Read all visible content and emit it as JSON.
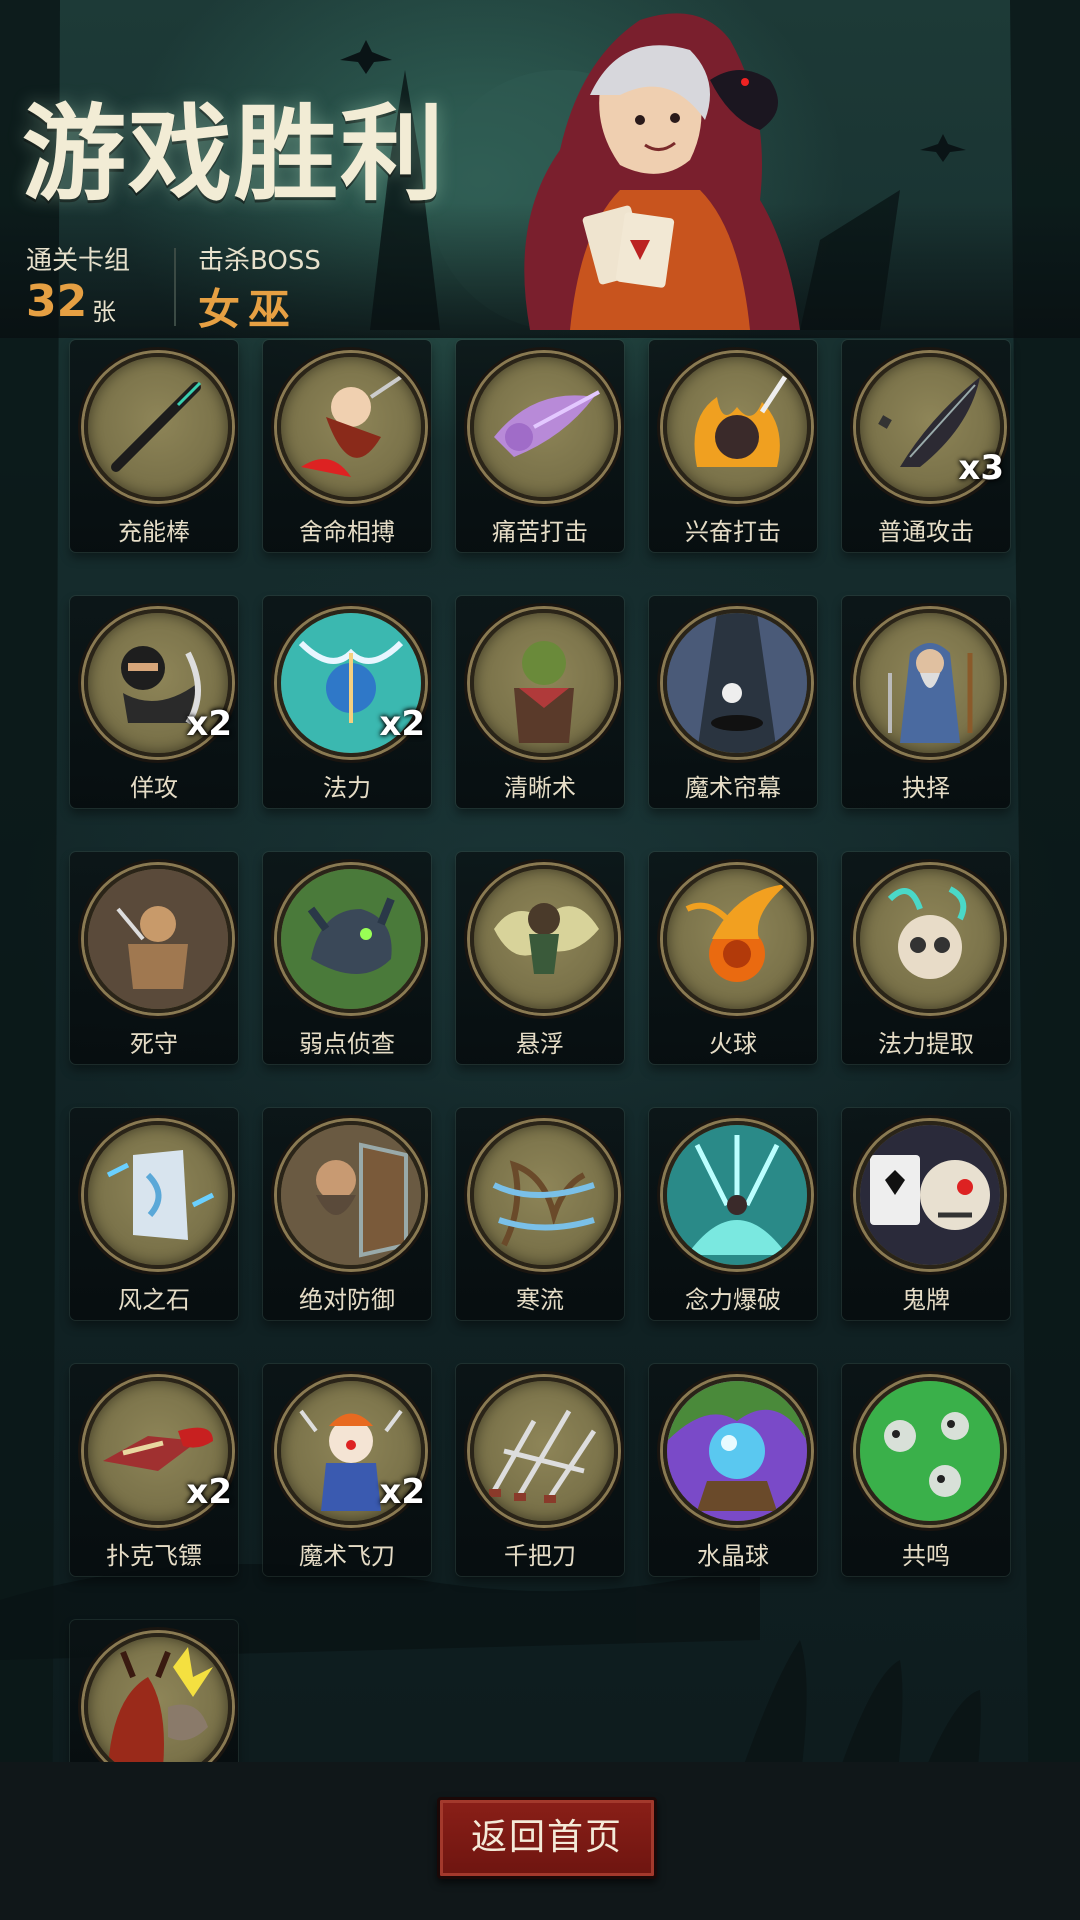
{
  "header": {
    "title": "游戏胜利",
    "deck_label": "通关卡组",
    "deck_count": "32",
    "deck_unit": "张",
    "boss_label": "击杀BOSS",
    "boss_name": "女巫"
  },
  "cards": [
    {
      "name": "充能棒",
      "count": "",
      "icon": "wand-icon"
    },
    {
      "name": "舍命相搏",
      "count": "",
      "icon": "desperate-fighter-icon"
    },
    {
      "name": "痛苦打击",
      "count": "",
      "icon": "pain-strike-icon"
    },
    {
      "name": "兴奋打击",
      "count": "",
      "icon": "excited-strike-icon"
    },
    {
      "name": "普通攻击",
      "count": "x3",
      "icon": "feather-attack-icon"
    },
    {
      "name": "佯攻",
      "count": "x2",
      "icon": "ninja-feint-icon"
    },
    {
      "name": "法力",
      "count": "x2",
      "icon": "mana-orb-icon"
    },
    {
      "name": "清晰术",
      "count": "",
      "icon": "goblin-icon"
    },
    {
      "name": "魔术帘幕",
      "count": "",
      "icon": "magic-curtain-icon"
    },
    {
      "name": "抉择",
      "count": "",
      "icon": "wizard-choice-icon"
    },
    {
      "name": "死守",
      "count": "",
      "icon": "defender-icon"
    },
    {
      "name": "弱点侦查",
      "count": "",
      "icon": "wolf-icon"
    },
    {
      "name": "悬浮",
      "count": "",
      "icon": "levitate-icon"
    },
    {
      "name": "火球",
      "count": "",
      "icon": "fireball-icon"
    },
    {
      "name": "法力提取",
      "count": "",
      "icon": "skull-mana-icon"
    },
    {
      "name": "风之石",
      "count": "",
      "icon": "wind-stone-icon"
    },
    {
      "name": "绝对防御",
      "count": "",
      "icon": "dwarf-shield-icon"
    },
    {
      "name": "寒流",
      "count": "",
      "icon": "cold-wave-icon"
    },
    {
      "name": "念力爆破",
      "count": "",
      "icon": "telekinetic-blast-icon"
    },
    {
      "name": "鬼牌",
      "count": "",
      "icon": "skull-card-icon"
    },
    {
      "name": "扑克飞镖",
      "count": "x2",
      "icon": "card-dart-icon"
    },
    {
      "name": "魔术飞刀",
      "count": "x2",
      "icon": "clown-knives-icon"
    },
    {
      "name": "千把刀",
      "count": "",
      "icon": "thousand-knives-icon"
    },
    {
      "name": "水晶球",
      "count": "",
      "icon": "crystal-ball-icon"
    },
    {
      "name": "共鸣",
      "count": "",
      "icon": "resonance-skulls-icon"
    },
    {
      "name": "",
      "count": "",
      "icon": "demon-strike-icon"
    }
  ],
  "footer": {
    "home_button": "返回首页"
  },
  "colors": {
    "accent": "#e6a043",
    "button": "#7d1a14",
    "medal": "#7c744b"
  }
}
